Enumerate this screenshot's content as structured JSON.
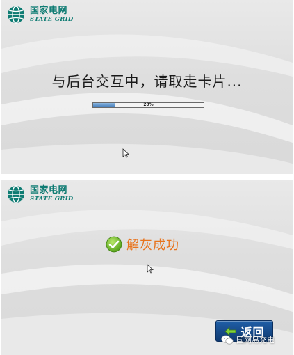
{
  "brand": {
    "name_cn": "国家电网",
    "name_en": "STATE GRID",
    "color": "#0f7c73"
  },
  "screen_processing": {
    "message": "与后台交互中，请取走卡片...",
    "progress": {
      "percent": 20,
      "label": "20%"
    }
  },
  "screen_success": {
    "message": "解灰成功",
    "message_color": "#e8731c",
    "back_button_label": "返回"
  },
  "watermark": {
    "text": "国网易充电"
  }
}
